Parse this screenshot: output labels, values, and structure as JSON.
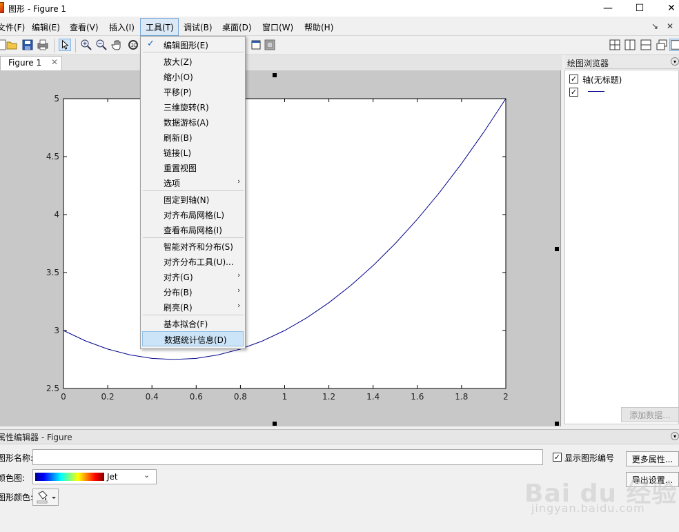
{
  "window": {
    "title": "图形 - Figure 1",
    "controls": [
      "—",
      "☐",
      "✕"
    ]
  },
  "menubar": {
    "items": [
      "文件(F)",
      "编辑(E)",
      "查看(V)",
      "插入(I)",
      "工具(T)",
      "调试(B)",
      "桌面(D)",
      "窗口(W)",
      "帮助(H)"
    ],
    "active_index": 4,
    "undock": "↘",
    "close": "✕"
  },
  "toolbar": {
    "icons": [
      "new-icon",
      "open-icon",
      "save-icon",
      "print-icon",
      "pointer-icon",
      "zoom-in-icon",
      "zoom-out-icon",
      "pan-icon",
      "rotate-icon"
    ],
    "layout_icons": [
      "tile-icon",
      "split-vertical-icon",
      "split-horizontal-icon",
      "float-icon",
      "dock-icon"
    ]
  },
  "tab": {
    "label": "Figure 1",
    "close": "✕"
  },
  "tools_menu": {
    "items": [
      {
        "label": "编辑图形(E)",
        "checked": true
      },
      {
        "label": "放大(Z)"
      },
      {
        "label": "缩小(O)"
      },
      {
        "label": "平移(P)"
      },
      {
        "label": "三维旋转(R)"
      },
      {
        "label": "数据游标(A)"
      },
      {
        "label": "刷新(B)"
      },
      {
        "label": "链接(L)"
      },
      {
        "label": "重置视图"
      },
      {
        "label": "选项",
        "submenu": true
      },
      {
        "label": "固定到轴(N)"
      },
      {
        "label": "对齐布局网格(L)"
      },
      {
        "label": "查看布局网格(I)"
      },
      {
        "label": "智能对齐和分布(S)"
      },
      {
        "label": "对齐分布工具(U)..."
      },
      {
        "label": "对齐(G)",
        "submenu": true
      },
      {
        "label": "分布(B)",
        "submenu": true
      },
      {
        "label": "刷亮(R)",
        "submenu": true
      },
      {
        "label": "基本拟合(F)"
      },
      {
        "label": "数据统计信息(D)",
        "highlighted": true
      }
    ]
  },
  "plot_browser": {
    "title": "绘图浏览器",
    "collapse": "▾",
    "axes_label": "轴(无标题)",
    "add_data_label": "添加数据..."
  },
  "property_editor": {
    "title": "属性编辑器 - Figure",
    "collapse": "▾",
    "figure_name_label": "图形名称:",
    "figure_name_value": "",
    "colormap_label": "颜色图:",
    "colormap_value": "Jet",
    "figure_color_label": "图形颜色:",
    "show_number_label": "显示图形编号",
    "show_number_checked": true,
    "more_props_label": "更多属性...",
    "export_label": "导出设置..."
  },
  "watermark": {
    "text": "Bai du 经验",
    "url": "jingyan.baidu.com"
  },
  "chart_data": {
    "type": "line",
    "title": "",
    "xlabel": "",
    "ylabel": "",
    "xlim": [
      0,
      2
    ],
    "ylim": [
      2.5,
      5
    ],
    "xticks": [
      "0",
      "0.2",
      "0.4",
      "0.6",
      "0.8",
      "1",
      "1.2",
      "1.4",
      "1.6",
      "1.8",
      "2"
    ],
    "yticks": [
      "2.5",
      "3",
      "3.5",
      "4",
      "4.5",
      "5"
    ],
    "series": [
      {
        "color": "#00008b",
        "x": [
          0,
          0.1,
          0.2,
          0.3,
          0.4,
          0.5,
          0.6,
          0.7,
          0.8,
          0.9,
          1.0,
          1.1,
          1.2,
          1.3,
          1.4,
          1.5,
          1.6,
          1.7,
          1.8,
          1.9,
          2.0
        ],
        "y": [
          3.0,
          2.91,
          2.84,
          2.79,
          2.76,
          2.75,
          2.76,
          2.79,
          2.84,
          2.91,
          3.0,
          3.11,
          3.24,
          3.39,
          3.56,
          3.75,
          3.96,
          4.19,
          4.44,
          4.71,
          5.0
        ]
      }
    ]
  }
}
